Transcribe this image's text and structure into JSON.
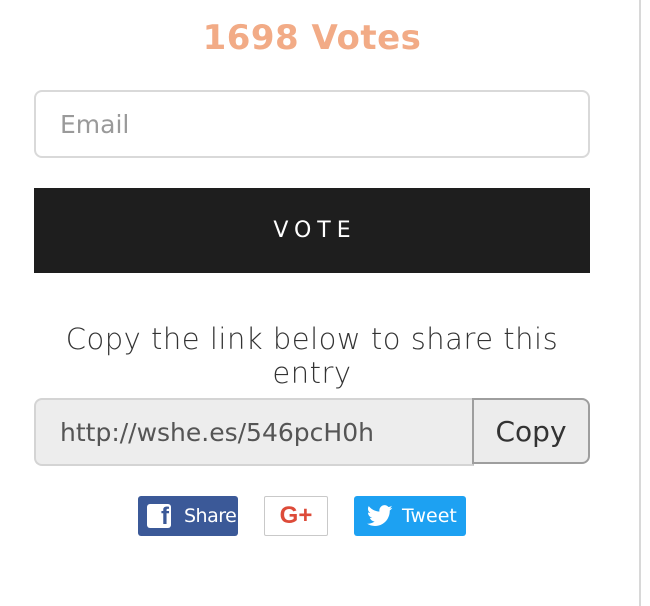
{
  "votes": {
    "text": "1698 Votes"
  },
  "email_input": {
    "placeholder": "Email",
    "value": ""
  },
  "vote_button": {
    "label": "VOTE"
  },
  "share_prompt": {
    "text": "Copy the link below to share this entry"
  },
  "share_link": {
    "value": "http://wshe.es/546pcH0h",
    "copy_label": "Copy"
  },
  "social": {
    "facebook": {
      "label": "Share",
      "icon": "facebook-icon",
      "color": "#3b5998"
    },
    "google_plus": {
      "label": "G+",
      "icon": "google-plus-icon",
      "color": "#dd4b39"
    },
    "twitter": {
      "label": "Tweet",
      "icon": "twitter-bird-icon",
      "color": "#1da1f2"
    }
  },
  "colors": {
    "votes": "#f2ab86",
    "vote_button_bg": "#1e1e1e"
  }
}
